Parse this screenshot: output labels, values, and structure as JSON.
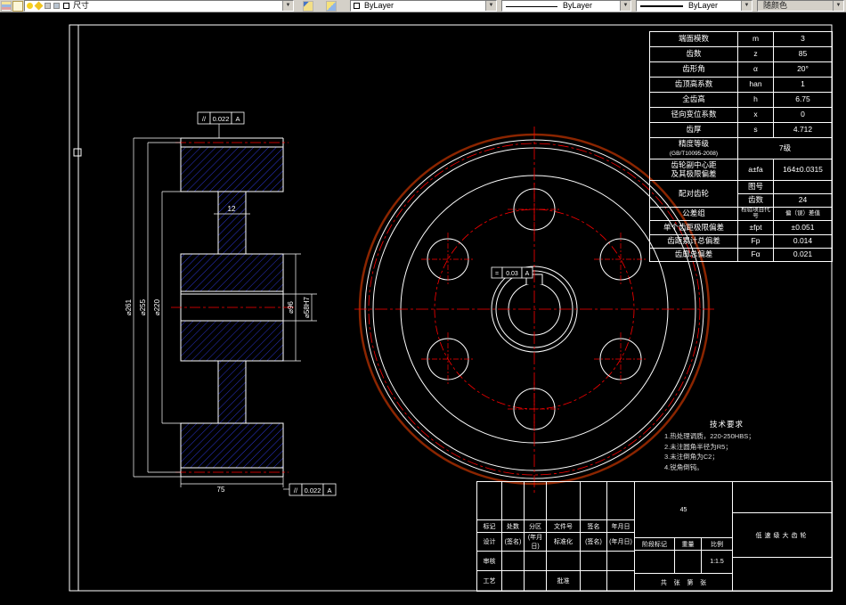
{
  "toolbar": {
    "layer_name": "尺寸",
    "color_value": "ByLayer",
    "linetype_value": "ByLayer",
    "lineweight_value": "ByLayer",
    "plotstyle_value": "随颜色"
  },
  "icons": {
    "dropdown_arrow": "▼"
  },
  "colors": {
    "hatch_blue": "#2b35cc",
    "centerline_red": "#ff0000",
    "outer_ring_maroon": "#8b2500",
    "line_white": "#ffffff",
    "toolbar_gray": "#d4d0c8"
  },
  "param_table": {
    "r1": {
      "label": "端面模数",
      "sym": "m",
      "val": "3"
    },
    "r2": {
      "label": "齿数",
      "sym": "z",
      "val": "85"
    },
    "r3": {
      "label": "齿形角",
      "sym": "α",
      "val": "20°"
    },
    "r4": {
      "label": "齿顶高系数",
      "sym": "han",
      "val": "1"
    },
    "r5": {
      "label": "全齿高",
      "sym": "h",
      "val": "6.75"
    },
    "r6": {
      "label": "径向变位系数",
      "sym": "x",
      "val": "0"
    },
    "r7": {
      "label": "齿厚",
      "sym": "s",
      "val": "4.712"
    },
    "r8": {
      "label": "精度等级",
      "label2": "(GB/T10095-2008)",
      "val": "7级"
    },
    "r9": {
      "label": "齿轮副中心距",
      "label2": "及其极限偏差",
      "sym": "a±fa",
      "val": "164±0.0315"
    },
    "r10": {
      "label": "配对齿轮",
      "sym": "图号",
      "val": ""
    },
    "r11": {
      "sym": "齿数",
      "val": "24"
    },
    "r12": {
      "label": "公差组",
      "sym": "检验项目代号",
      "val": "偏（误）差值"
    },
    "r13": {
      "label": "单个齿距极限偏差",
      "sym": "±fpt",
      "val": "±0.051"
    },
    "r14": {
      "label": "齿距累计总偏差",
      "sym": "Fp",
      "val": "0.014"
    },
    "r15": {
      "label": "齿廓总偏差",
      "sym": "Fα",
      "val": "0.021"
    }
  },
  "tech_req": {
    "title": "技术要求",
    "line1": "1.热处理调质，220-250HBS；",
    "line2": "2.未注圆角半径为R5；",
    "line3": "3.未注倒角为C2；",
    "line4": "4.锐角倒钝。"
  },
  "drawing": {
    "dims": {
      "tip_dia": "⌀261",
      "pitch_dia": "⌀255",
      "rim_dia": "⌀220",
      "hub_dia": "⌀96",
      "bore_dia": "⌀58H7",
      "web_width": "12",
      "face_width": "75"
    },
    "tol_top": {
      "sym": "//",
      "val": "0.022",
      "datum": "A"
    },
    "tol_bottom": {
      "sym": "//",
      "val": "0.022",
      "datum": "A"
    },
    "tol_keyway": {
      "sym": "=",
      "val": "0.03",
      "datum": "A"
    }
  },
  "title_block": {
    "material": "45",
    "part_name": "低速级大齿轮",
    "c_mark": "标记",
    "c_count": "处数",
    "c_zone": "分区",
    "c_doc": "文件号",
    "c_sign": "签名",
    "c_date": "年月日",
    "design": "设计",
    "sign_ph": "(签名)",
    "date_ph": "(年月日)",
    "standard": "标准化",
    "review": "审核",
    "process": "工艺",
    "approve": "批准",
    "stage": "阶段标记",
    "weight": "重量",
    "scale": "比例",
    "scale_value": "1:1.5",
    "sheets": "共    张    第    张"
  }
}
